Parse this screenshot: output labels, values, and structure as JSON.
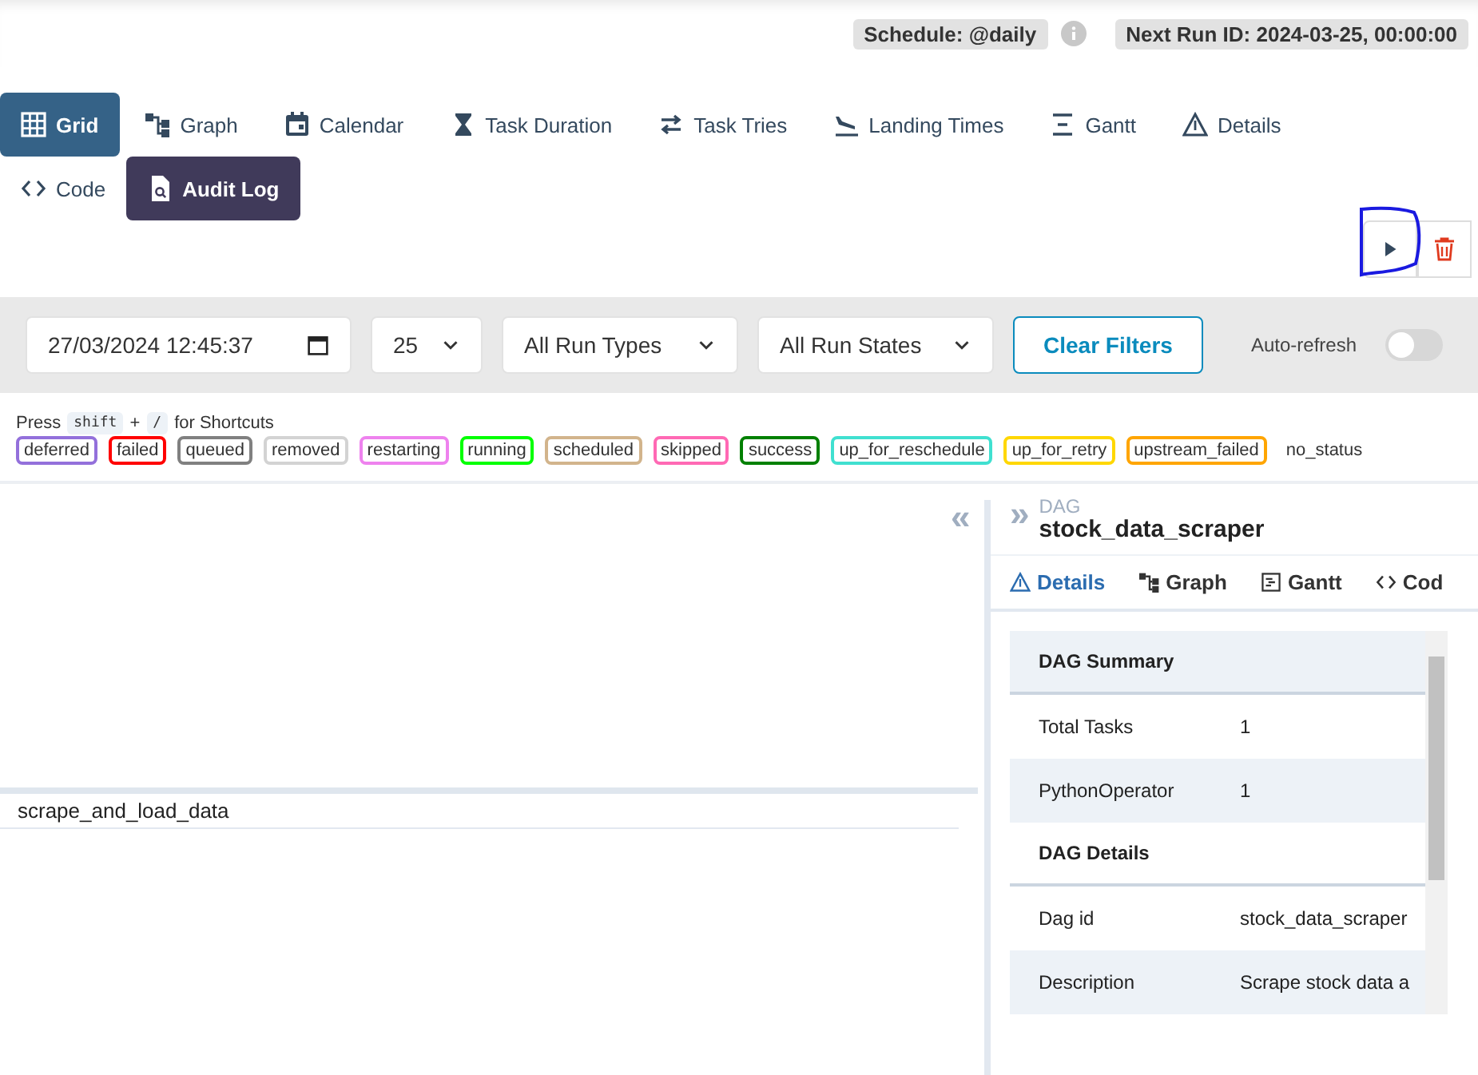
{
  "header": {
    "schedule": "Schedule: @daily",
    "next_run": "Next Run ID: 2024-03-25, 00:00:00"
  },
  "tabs": [
    {
      "label": "Grid",
      "selected": true,
      "hovered": false
    },
    {
      "label": "Graph",
      "selected": false,
      "hovered": false
    },
    {
      "label": "Calendar",
      "selected": false,
      "hovered": false
    },
    {
      "label": "Task Duration",
      "selected": false,
      "hovered": false
    },
    {
      "label": "Task Tries",
      "selected": false,
      "hovered": false
    },
    {
      "label": "Landing Times",
      "selected": false,
      "hovered": false
    },
    {
      "label": "Gantt",
      "selected": false,
      "hovered": false
    },
    {
      "label": "Details",
      "selected": false,
      "hovered": false
    },
    {
      "label": "Code",
      "selected": false,
      "hovered": false
    },
    {
      "label": "Audit Log",
      "selected": false,
      "hovered": true
    }
  ],
  "filters": {
    "date": "27/03/2024 12:45:37",
    "count": "25",
    "run_types": "All Run Types",
    "run_states": "All Run States",
    "clear": "Clear Filters",
    "auto_refresh_label": "Auto-refresh",
    "auto_refresh": false
  },
  "shortcuts": {
    "press": "Press",
    "key1": "shift",
    "plus": "+",
    "key2": "/",
    "suffix": "for Shortcuts"
  },
  "legend": [
    {
      "label": "deferred",
      "color": "#9370db"
    },
    {
      "label": "failed",
      "color": "#ff0000"
    },
    {
      "label": "queued",
      "color": "#808080"
    },
    {
      "label": "removed",
      "color": "#d3d3d3"
    },
    {
      "label": "restarting",
      "color": "#ee82ee"
    },
    {
      "label": "running",
      "color": "#00ff00"
    },
    {
      "label": "scheduled",
      "color": "#d2b48c"
    },
    {
      "label": "skipped",
      "color": "#ff69b4"
    },
    {
      "label": "success",
      "color": "#008000"
    },
    {
      "label": "up_for_reschedule",
      "color": "#40e0d0"
    },
    {
      "label": "up_for_retry",
      "color": "#ffd700"
    },
    {
      "label": "upstream_failed",
      "color": "#ffa500"
    },
    {
      "label": "no_status"
    }
  ],
  "grid": {
    "tasks": [
      "scrape_and_load_data"
    ]
  },
  "details": {
    "collapse": "«",
    "expand": "»",
    "caption": "DAG",
    "dag_name": "stock_data_scraper",
    "tabs": [
      {
        "label": "Details",
        "selected": true
      },
      {
        "label": "Graph",
        "selected": false
      },
      {
        "label": "Gantt",
        "selected": false
      },
      {
        "label": "Cod",
        "selected": false
      }
    ],
    "rows": [
      {
        "kind": "section",
        "label": "DAG Summary"
      },
      {
        "kind": "row",
        "label": "Total Tasks",
        "value": "1"
      },
      {
        "kind": "row",
        "label": "PythonOperator",
        "value": "1"
      },
      {
        "kind": "section",
        "label": "DAG Details"
      },
      {
        "kind": "row",
        "label": "Dag id",
        "value": "stock_data_scraper"
      },
      {
        "kind": "row",
        "label": "Description",
        "value": "Scrape stock data a"
      }
    ]
  }
}
